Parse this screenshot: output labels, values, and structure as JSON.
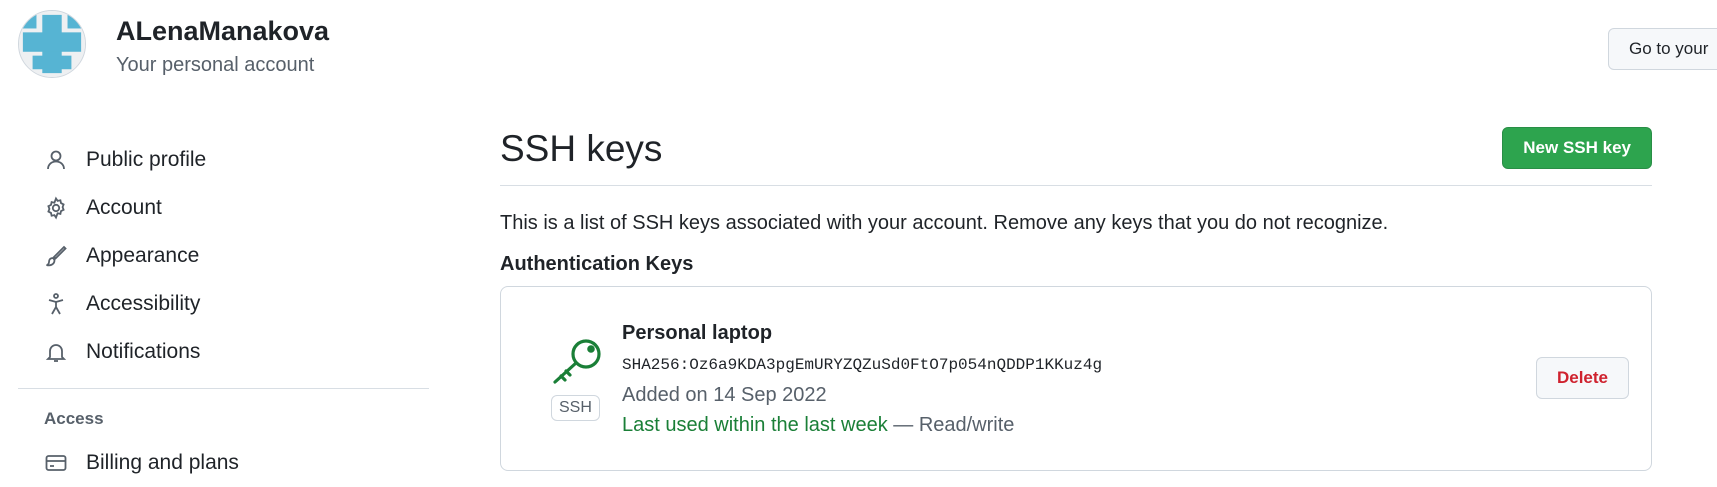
{
  "header": {
    "user_name": "ALenaManakova",
    "subtitle": "Your personal account",
    "go_button_label": "Go to your"
  },
  "sidebar": {
    "items": [
      {
        "label": "Public profile",
        "icon": "person-icon"
      },
      {
        "label": "Account",
        "icon": "gear-icon"
      },
      {
        "label": "Appearance",
        "icon": "paintbrush-icon"
      },
      {
        "label": "Accessibility",
        "icon": "accessibility-icon"
      },
      {
        "label": "Notifications",
        "icon": "bell-icon"
      }
    ],
    "section_heading": "Access",
    "access_items": [
      {
        "label": "Billing and plans",
        "icon": "credit-card-icon"
      }
    ]
  },
  "main": {
    "title": "SSH keys",
    "new_key_label": "New SSH key",
    "description": "This is a list of SSH keys associated with your account. Remove any keys that you do not recognize.",
    "subheading": "Authentication Keys",
    "keys": [
      {
        "title": "Personal laptop",
        "fingerprint": "SHA256:Oz6a9KDA3pgEmURYZQZuSd0FtO7p054nQDDP1KKuz4g",
        "added": "Added on 14 Sep 2022",
        "last_used": "Last used within the last week",
        "access": " — Read/write",
        "type_label": "SSH",
        "delete_label": "Delete"
      }
    ]
  },
  "colors": {
    "primary_button": "#2da44e",
    "danger_text": "#cf222e",
    "success_text": "#1a7f37"
  }
}
